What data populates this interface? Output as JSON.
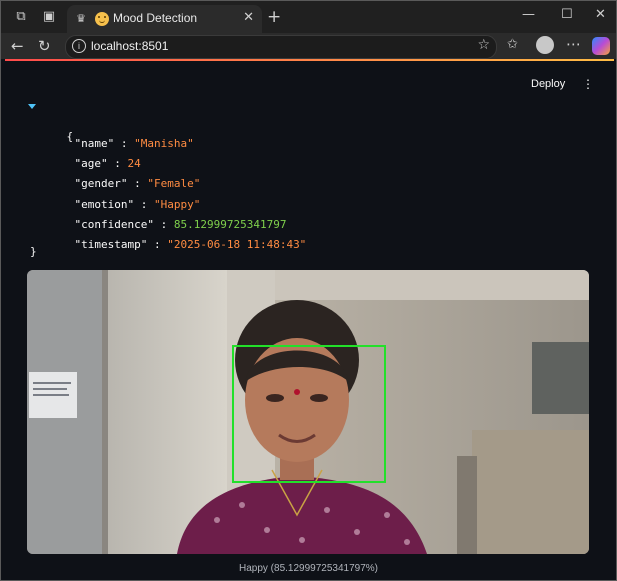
{
  "browser": {
    "tab_title": "Mood Detection",
    "url": "localhost:8501"
  },
  "app": {
    "deploy_label": "Deploy",
    "json_open": "{",
    "json_close": "}",
    "fields": [
      {
        "key": "\"name\"",
        "value": "\"Manisha\"",
        "kind": "string"
      },
      {
        "key": "\"age\"",
        "value": "24",
        "kind": "number"
      },
      {
        "key": "\"gender\"",
        "value": "\"Female\"",
        "kind": "string"
      },
      {
        "key": "\"emotion\"",
        "value": "\"Happy\"",
        "kind": "string"
      },
      {
        "key": "\"confidence\"",
        "value": "85.12999725341797",
        "kind": "float"
      },
      {
        "key": "\"timestamp\"",
        "value": "\"2025-06-18 11:48:43\"",
        "kind": "string"
      }
    ],
    "caption": "Happy (85.12999725341797%)"
  },
  "colors": {
    "accent_start": "#ff4b4b",
    "accent_end": "#ffbd45",
    "face_box": "#22e02a",
    "app_bg": "#0e1117"
  }
}
